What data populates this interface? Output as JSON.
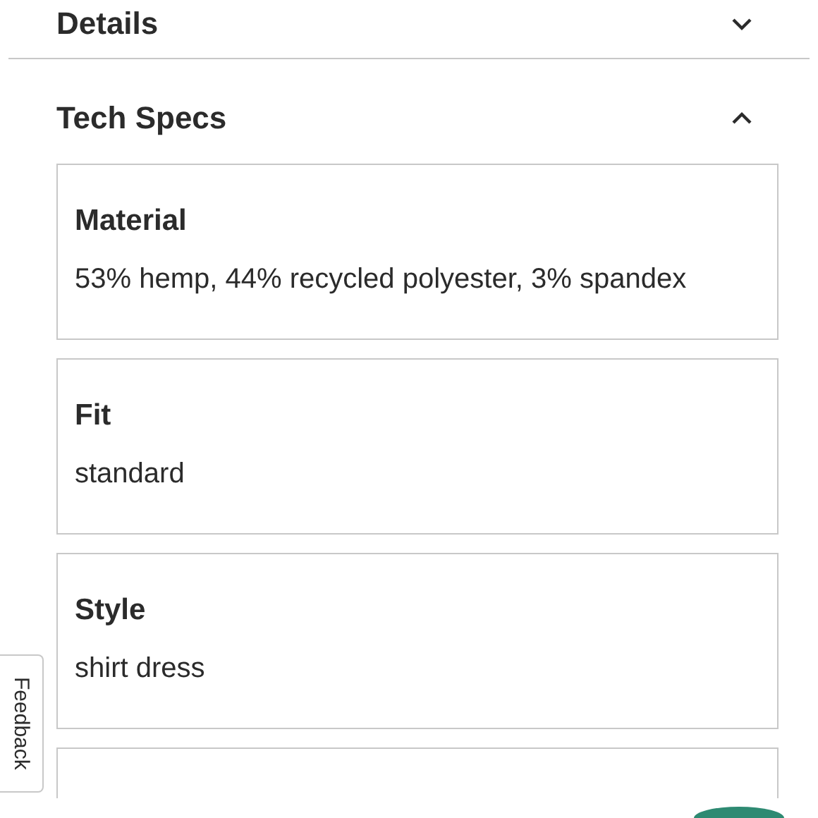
{
  "sections": [
    {
      "title": "Details",
      "expanded": false
    },
    {
      "title": "Tech Specs",
      "expanded": true,
      "specs": [
        {
          "kind": "spec",
          "label": "Material",
          "value": "53% hemp, 44% recycled polyester, 3% spandex"
        },
        {
          "kind": "spec",
          "label": "Fit",
          "value": "standard"
        },
        {
          "kind": "spec",
          "label": "Style",
          "value": "shirt dress"
        },
        {
          "kind": "partial"
        }
      ]
    }
  ],
  "feedback_tab": {
    "label": "Feedback"
  },
  "chat_button": {
    "visible": true
  }
}
